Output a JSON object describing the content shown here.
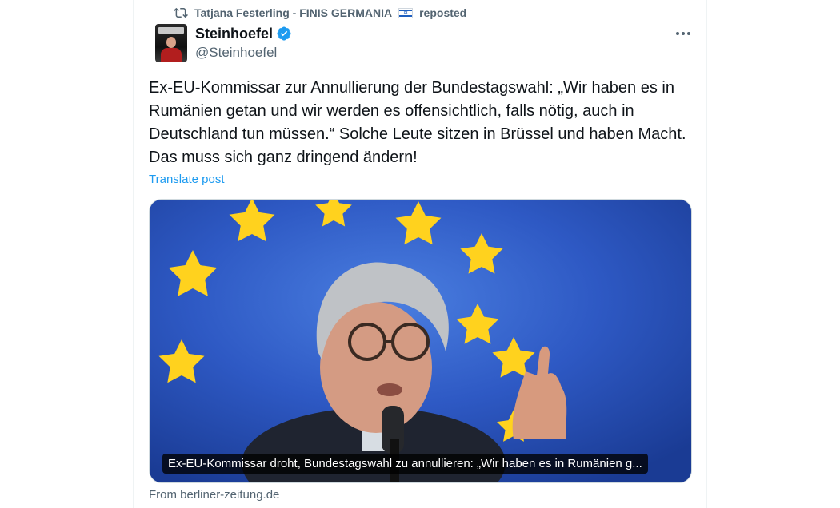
{
  "repost": {
    "user": "Tatjana Festerling - FINIS GERMANIA",
    "flag_icon": "israel-flag-icon",
    "action": "reposted"
  },
  "author": {
    "name": "Steinhoefel",
    "handle": "@Steinhoefel",
    "verified": true,
    "verified_color": "#1d9bf0"
  },
  "post": {
    "text": "Ex-EU-Kommissar zur Annullierung der Bundestagswahl: „Wir haben es in Rumänien getan und wir werden es offensichtlich, falls nötig, auch in Deutschland tun müssen.“ Solche Leute sitzen in Brüssel und haben Macht. Das muss sich ganz dringend ändern!",
    "translate_label": "Translate post"
  },
  "card": {
    "caption": "Ex-EU-Kommissar droht, Bundestagswahl zu annullieren: „Wir haben es in Rumänien g...",
    "source": "From berliner-zeitung.de"
  },
  "colors": {
    "accent": "#1d9bf0",
    "secondary_text": "#536471",
    "primary_text": "#0f1419"
  }
}
